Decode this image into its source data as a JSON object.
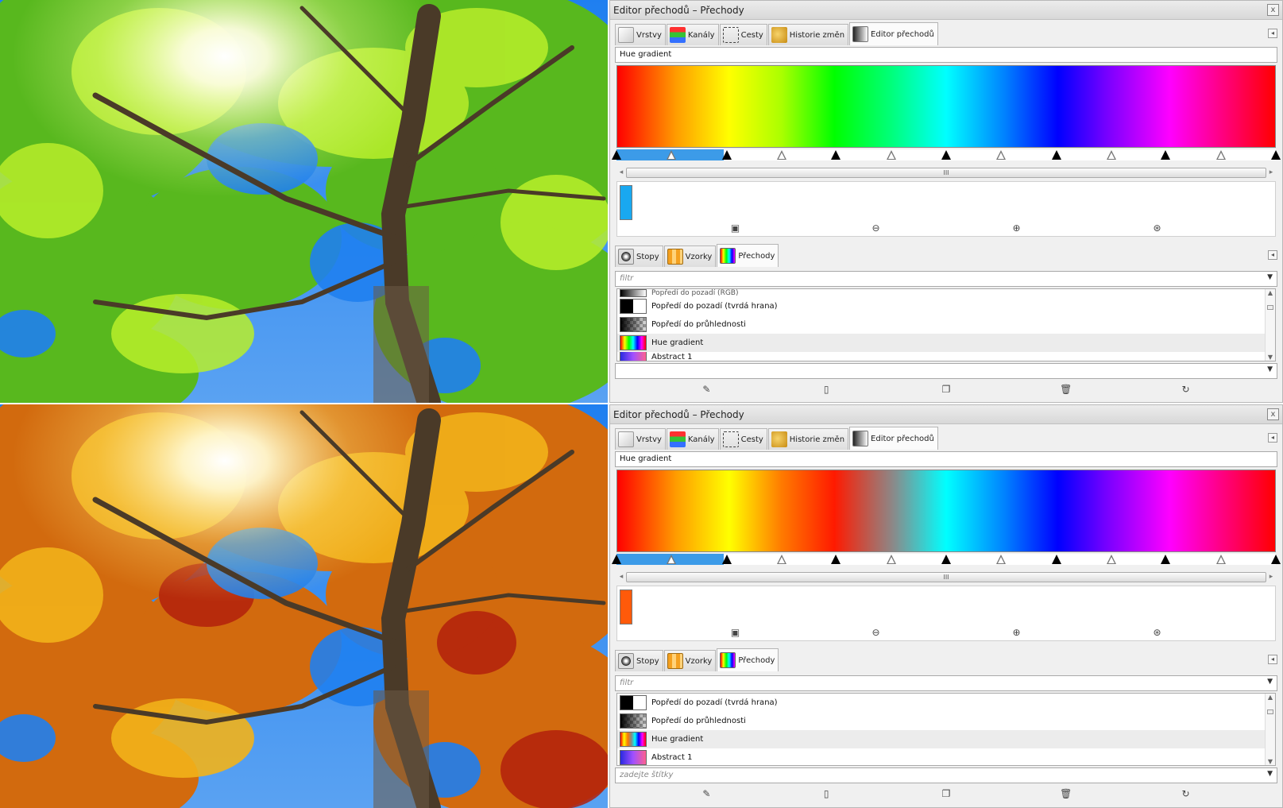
{
  "panels": [
    {
      "title": "Editor přechodů – Přechody",
      "close": "x",
      "tabs": [
        "Vrstvy",
        "Kanály",
        "Cesty",
        "Historie změn",
        "Editor přechodů"
      ],
      "gradient_name": "Hue gradient",
      "scroll_grip": "III",
      "selected_color": "#19a8f0",
      "bottom_tabs": [
        "Stopy",
        "Vzorky",
        "Přechody"
      ],
      "filter_placeholder": "filtr",
      "list_partial": "Popředí do pozadí (RGB)",
      "list": [
        "Popředí do pozadí (tvrdá hrana)",
        "Popředí do průhlednosti",
        "Hue gradient",
        "Abstract 1"
      ],
      "tag_placeholder": ""
    },
    {
      "title": "Editor přechodů – Přechody",
      "close": "x",
      "tabs": [
        "Vrstvy",
        "Kanály",
        "Cesty",
        "Historie změn",
        "Editor přechodů"
      ],
      "gradient_name": "Hue gradient",
      "scroll_grip": "III",
      "selected_color": "#ff5a0a",
      "bottom_tabs": [
        "Stopy",
        "Vzorky",
        "Přechody"
      ],
      "filter_placeholder": "filtr",
      "list": [
        "Popředí do pozadí (tvrdá hrana)",
        "Popředí do průhlednosti",
        "Hue gradient",
        "Abstract 1"
      ],
      "tag_placeholder": "zadejte štítky"
    }
  ]
}
